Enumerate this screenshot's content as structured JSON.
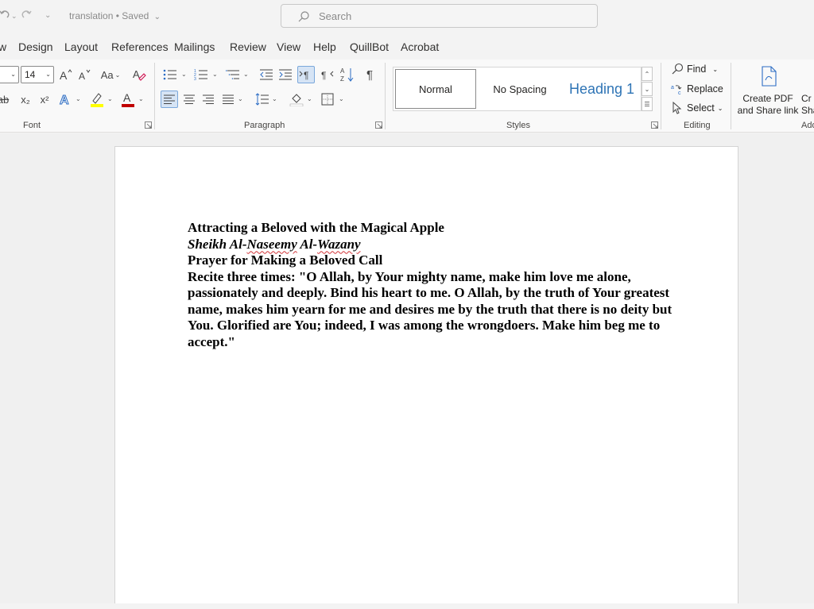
{
  "title_bar": {
    "doc_name": "translation",
    "save_status": "Saved",
    "separator": "•",
    "search_placeholder": "Search"
  },
  "tabs": [
    {
      "label": "w"
    },
    {
      "label": "Design"
    },
    {
      "label": "Layout"
    },
    {
      "label": "References"
    },
    {
      "label": "Mailings"
    },
    {
      "label": "Review"
    },
    {
      "label": "View"
    },
    {
      "label": "Help"
    },
    {
      "label": "QuillBot"
    },
    {
      "label": "Acrobat"
    }
  ],
  "ribbon": {
    "font": {
      "group_label": "Font",
      "font_size": "14",
      "change_case_label": "Aa",
      "grow_font": "A^",
      "shrink_font": "Aˇ",
      "strikethrough": "ab",
      "subscript": "x₂",
      "superscript": "x²"
    },
    "paragraph": {
      "group_label": "Paragraph"
    },
    "styles": {
      "group_label": "Styles",
      "items": [
        {
          "label": "Normal",
          "selected": true
        },
        {
          "label": "No Spacing",
          "selected": false
        },
        {
          "label": "Heading 1",
          "selected": false
        }
      ]
    },
    "editing": {
      "group_label": "Editing",
      "find": "Find",
      "replace": "Replace",
      "select": "Select"
    },
    "acrobat": {
      "create_pdf_line1": "Create PDF",
      "create_pdf_line2": "and Share link",
      "partial_line1": "Cr",
      "partial_line2": "Sha",
      "partial_group": "Add"
    }
  },
  "document": {
    "title": "Attracting a Beloved with the Magical Apple",
    "author_prefix": "Sheikh Al-",
    "author_name1": "Naseemy",
    "author_mid": " Al-",
    "author_name2": "Wazany",
    "heading": "Prayer for Making a Beloved Call",
    "body": "Recite three times: \"O Allah, by Your mighty name, make him love me alone, passionately and deeply. Bind his heart to me. O Allah, by the truth of Your greatest name, makes him yearn for me and desires me by the truth that there is no deity but You. Glorified are You; indeed, I was among the wrongdoers. Make him beg me to accept.\""
  },
  "colors": {
    "font_color": "#c00000",
    "highlight_color": "#ffff00",
    "heading_blue": "#2e74b5",
    "spell_error": "#d13438"
  }
}
